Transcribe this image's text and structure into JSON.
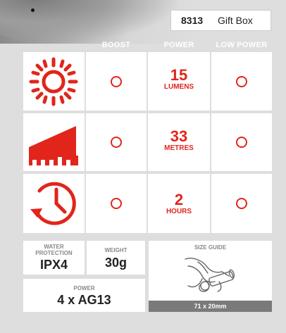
{
  "product": {
    "code": "8313",
    "name": "Gift Box"
  },
  "columns": {
    "boost": "BOOST",
    "power": "POWER",
    "low_power": "LOW POWER"
  },
  "colors": {
    "accent": "#e1251b",
    "cell": "#ffffff",
    "background": "#dedede"
  },
  "rows": [
    {
      "icon": "sun-icon",
      "value": "15",
      "unit": "LUMENS"
    },
    {
      "icon": "beam-distance-icon",
      "value": "33",
      "unit": "METRES"
    },
    {
      "icon": "clock-icon",
      "value": "2",
      "unit": "HOURS"
    }
  ],
  "specs": {
    "water_label": "WATER\nPROTECTION",
    "water_value": "IPX4",
    "weight_label": "WEIGHT",
    "weight_value": "30g",
    "size_label": "SIZE GUIDE",
    "size_value": "71 x 20mm",
    "power_label": "POWER",
    "power_value": "4 x AG13"
  }
}
